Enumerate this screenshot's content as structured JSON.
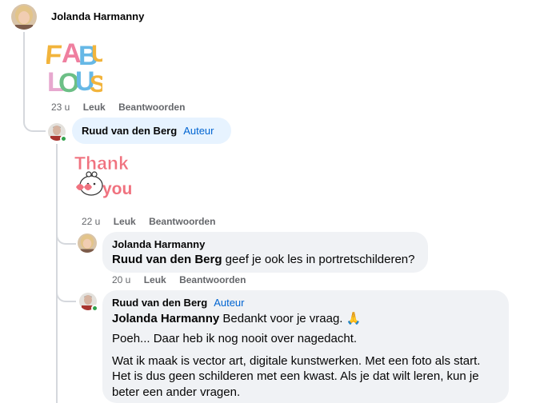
{
  "comments": [
    {
      "author": "Jolanda Harmanny",
      "sticker": "FABULOUS",
      "time": "23 u",
      "like_label": "Leuk",
      "reply_label": "Beantwoorden"
    },
    {
      "author": "Ruud van den Berg",
      "author_tag": "Auteur",
      "sticker_line1": "Thank",
      "sticker_line2": "you",
      "time": "22 u",
      "like_label": "Leuk",
      "reply_label": "Beantwoorden"
    },
    {
      "author": "Jolanda Harmanny",
      "mention": "Ruud van den Berg",
      "text": " geef je ook les in portretschilderen?",
      "time": "20 u",
      "like_label": "Leuk",
      "reply_label": "Beantwoorden"
    },
    {
      "author": "Ruud van den Berg",
      "author_tag": "Auteur",
      "mention": "Jolanda Harmanny",
      "text": " Bedankt voor je vraag. 🙏",
      "para2": "Poeh... Daar heb ik nog nooit over nagedacht.",
      "para3": "Wat ik maak is vector art, digitale kunstwerken. Met een foto als start. Het is dus geen schilderen met een kwast. Als je dat wilt leren, kun je beter een ander vragen."
    }
  ],
  "colors": {
    "author_tag": "#0064d1",
    "bubble": "#f0f2f5",
    "author_bubble": "#e7f3ff",
    "online_dot": "#31a24c",
    "meta_text": "#65676b"
  }
}
